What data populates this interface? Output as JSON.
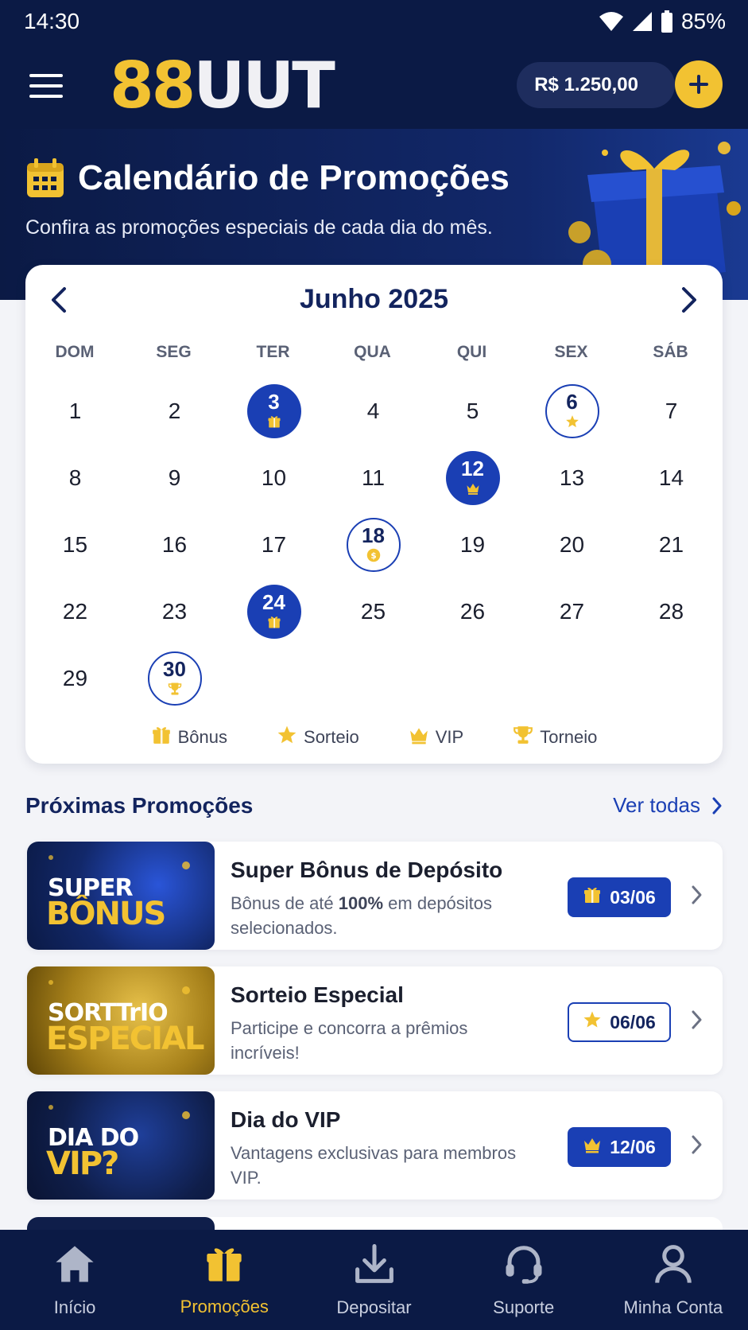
{
  "status_bar": {
    "time": "14:30",
    "battery": "85%"
  },
  "header": {
    "logo_part1": "88",
    "logo_part2": "UUT",
    "balance": "R$ 1.250,00",
    "colors": {
      "background": "#0b1a45",
      "gold": "#f2c232",
      "primary": "#1a3fb4"
    }
  },
  "hero": {
    "title": "Calendário de Promoções",
    "subtitle": "Confira as promoções especiais de cada dia do mês."
  },
  "calendar": {
    "month_label": "Junho 2025",
    "weekdays": [
      "DOM",
      "SEG",
      "TER",
      "QUA",
      "QUI",
      "SEX",
      "SÁB"
    ],
    "days": [
      {
        "n": "1"
      },
      {
        "n": "2"
      },
      {
        "n": "3",
        "style": "filled",
        "icon": "gift-icon"
      },
      {
        "n": "4"
      },
      {
        "n": "5"
      },
      {
        "n": "6",
        "style": "outline",
        "icon": "star-icon"
      },
      {
        "n": "7"
      },
      {
        "n": "8"
      },
      {
        "n": "9"
      },
      {
        "n": "10"
      },
      {
        "n": "11"
      },
      {
        "n": "12",
        "style": "filled",
        "icon": "crown-icon"
      },
      {
        "n": "13"
      },
      {
        "n": "14"
      },
      {
        "n": "15"
      },
      {
        "n": "16"
      },
      {
        "n": "17"
      },
      {
        "n": "18",
        "style": "outline",
        "icon": "coin-icon"
      },
      {
        "n": "19"
      },
      {
        "n": "20"
      },
      {
        "n": "21"
      },
      {
        "n": "22"
      },
      {
        "n": "23"
      },
      {
        "n": "24",
        "style": "filled",
        "icon": "gift-icon"
      },
      {
        "n": "25"
      },
      {
        "n": "26"
      },
      {
        "n": "27"
      },
      {
        "n": "28"
      },
      {
        "n": "29"
      },
      {
        "n": "30",
        "style": "outline",
        "icon": "trophy-icon"
      }
    ],
    "legend": [
      {
        "label": "Bônus",
        "icon": "gift-icon"
      },
      {
        "label": "Sorteio",
        "icon": "star-icon"
      },
      {
        "label": "VIP",
        "icon": "crown-icon"
      },
      {
        "label": "Torneio",
        "icon": "trophy-icon"
      }
    ]
  },
  "upcoming": {
    "title": "Próximas Promoções",
    "see_all": "Ver todas",
    "items": [
      {
        "title": "Super Bônus de Depósito",
        "desc_before": "Bônus de até ",
        "desc_bold": "100%",
        "desc_after": " em depósitos selecionados.",
        "date": "03/06",
        "date_icon": "gift-icon",
        "style": "filled",
        "thumb_line1": "SUPER",
        "thumb_line2": "BÔNUS"
      },
      {
        "title": "Sorteio Especial",
        "desc_before": "Participe e concorra a prêmios incríveis!",
        "desc_bold": "",
        "desc_after": "",
        "date": "06/06",
        "date_icon": "star-icon",
        "style": "outline",
        "thumb_line1": "SORTTrIO",
        "thumb_line2": "ESPECIAL"
      },
      {
        "title": "Dia do VIP",
        "desc_before": "Vantagens exclusivas para membros VIP.",
        "desc_bold": "",
        "desc_after": "",
        "date": "12/06",
        "date_icon": "crown-icon",
        "style": "filled",
        "thumb_line1": "DIA DO",
        "thumb_line2": "VIP?"
      }
    ]
  },
  "bottom_nav": [
    {
      "label": "Início",
      "icon": "home-icon"
    },
    {
      "label": "Promoções",
      "icon": "gift-icon",
      "active": true
    },
    {
      "label": "Depositar",
      "icon": "download-icon"
    },
    {
      "label": "Suporte",
      "icon": "headset-icon"
    },
    {
      "label": "Minha Conta",
      "icon": "user-icon"
    }
  ]
}
